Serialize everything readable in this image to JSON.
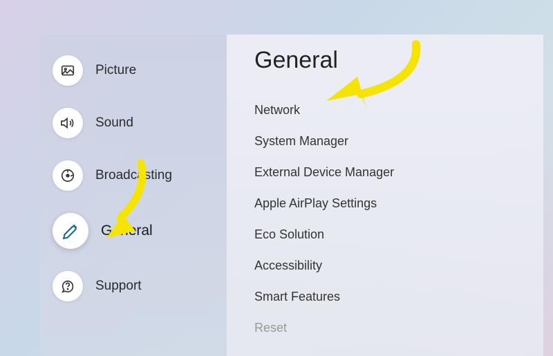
{
  "sidebar": {
    "items": [
      {
        "id": "picture",
        "label": "Picture",
        "selected": false
      },
      {
        "id": "sound",
        "label": "Sound",
        "selected": false
      },
      {
        "id": "broadcasting",
        "label": "Broadcasting",
        "selected": false
      },
      {
        "id": "general",
        "label": "General",
        "selected": true
      },
      {
        "id": "support",
        "label": "Support",
        "selected": false
      }
    ]
  },
  "content": {
    "title": "General",
    "items": [
      "Network",
      "System Manager",
      "External Device Manager",
      "Apple AirPlay Settings",
      "Eco Solution",
      "Accessibility",
      "Smart Features"
    ],
    "cutoff_item": "Reset"
  },
  "annotations": {
    "arrow_color": "#f5e400"
  }
}
